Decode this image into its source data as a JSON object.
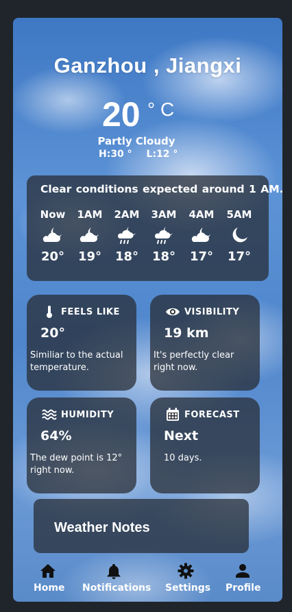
{
  "location": {
    "city": "Ganzhou , Jiangxi"
  },
  "current": {
    "temp": "20",
    "unit": "° C",
    "condition": "Partly Cloudy",
    "high": "H:30 °",
    "low": "L:12 °"
  },
  "hourly": {
    "summary": "Clear  conditions expected around 1 AM.",
    "items": [
      {
        "label": "Now",
        "icon": "cloud-moon-icon",
        "temp": "20°"
      },
      {
        "label": "1AM",
        "icon": "cloud-moon-icon",
        "temp": "19°"
      },
      {
        "label": "2AM",
        "icon": "cloud-moon-rain-icon",
        "temp": "18°"
      },
      {
        "label": "3AM",
        "icon": "cloud-moon-rain-icon",
        "temp": "18°"
      },
      {
        "label": "4AM",
        "icon": "cloud-moon-icon",
        "temp": "17°"
      },
      {
        "label": "5AM",
        "icon": "moon-icon",
        "temp": "17°"
      }
    ]
  },
  "tiles": {
    "feels_like": {
      "title": "FEELS LIKE",
      "value": "20°",
      "desc": "Similiar to the actual temperature."
    },
    "visibility": {
      "title": "VISIBILITY",
      "value": "19 km",
      "desc": "It's perfectly clear right now."
    },
    "humidity": {
      "title": "HUMIDITY",
      "value": "64%",
      "desc": "The dew point is 12° right now."
    },
    "forecast": {
      "title": "FORECAST",
      "value": "Next",
      "desc": "10 days."
    }
  },
  "notes": {
    "title": "Weather Notes"
  },
  "nav": {
    "home": "Home",
    "notifications": "Notifications",
    "settings": "Settings",
    "profile": "Profile"
  },
  "colors": {
    "card": "#262a30",
    "background": "#20252b",
    "text": "#ffffff"
  }
}
